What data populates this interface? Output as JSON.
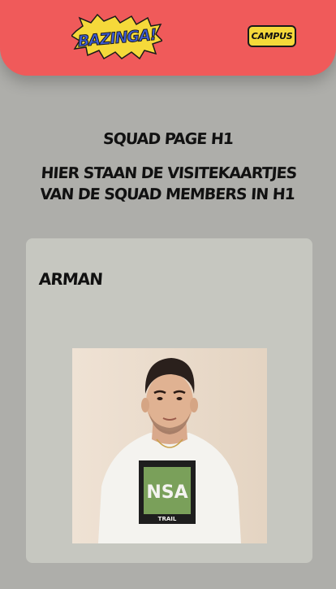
{
  "header": {
    "logo_text": "BAZINGA!",
    "campus_label": "CAMPUS"
  },
  "page": {
    "title": "SQUAD PAGE H1",
    "subtitle": "HIER STAAN DE VISITEKAARTJES VAN DE SQUAD MEMBERS IN H1"
  },
  "members": [
    {
      "name": "ARMAN"
    }
  ],
  "colors": {
    "header_bg": "#f05a5a",
    "page_bg": "#aeaeaa",
    "card_bg": "#c6c7c0",
    "button_bg": "#f5d93a"
  }
}
